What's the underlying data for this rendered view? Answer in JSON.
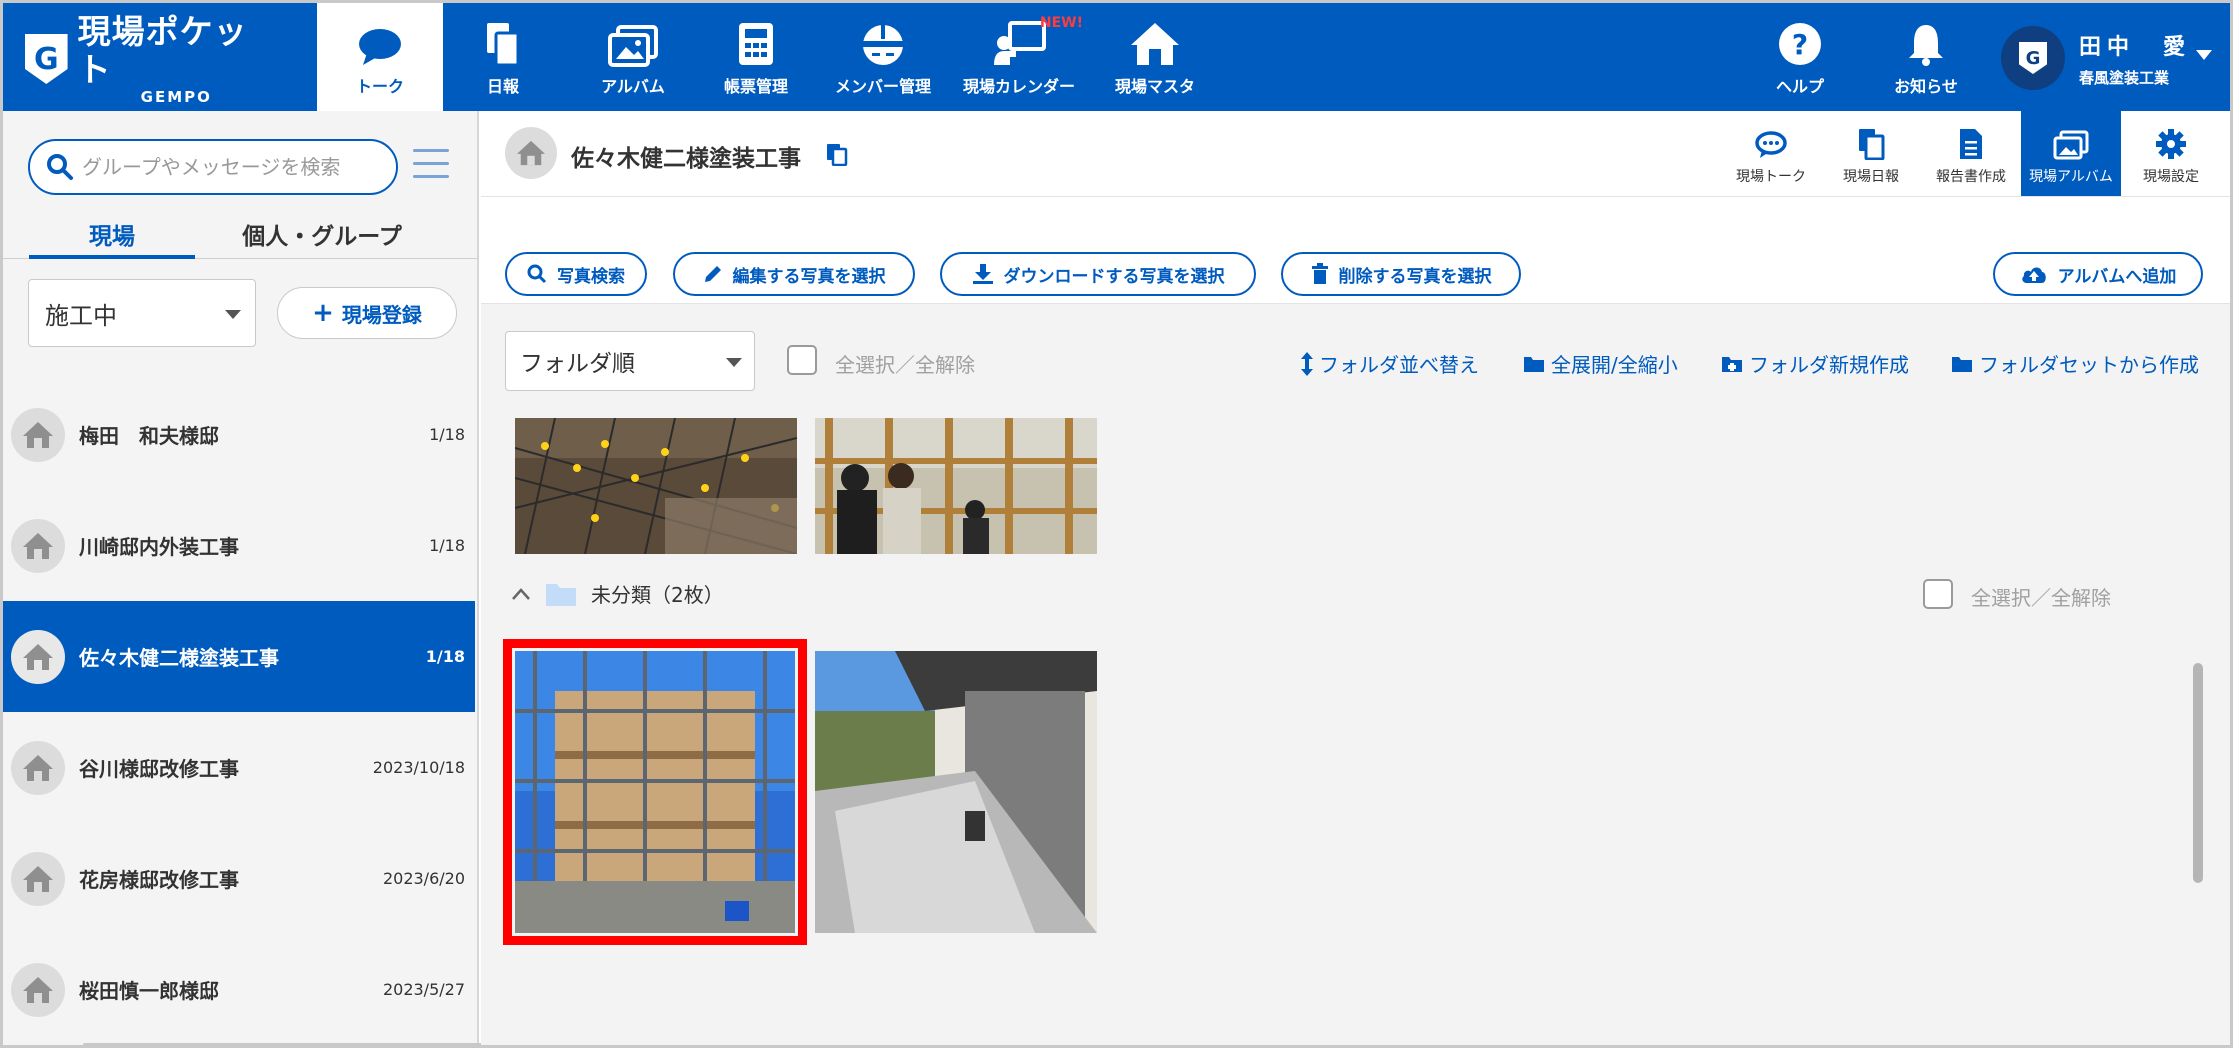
{
  "app": {
    "logo_title": "現場ポケット",
    "logo_sub": "GEMPO",
    "brand_color": "#005bbf"
  },
  "nav": [
    {
      "label": "トーク",
      "icon": "chat-bubble-icon",
      "active": true
    },
    {
      "label": "日報",
      "icon": "daily-report-icon"
    },
    {
      "label": "アルバム",
      "icon": "album-icon"
    },
    {
      "label": "帳票管理",
      "icon": "calculator-icon"
    },
    {
      "label": "メンバー管理",
      "icon": "helmet-icon"
    },
    {
      "label": "現場カレンダー",
      "icon": "presenter-icon",
      "badge": "NEW!"
    },
    {
      "label": "現場マスタ",
      "icon": "house-icon"
    }
  ],
  "header_right": {
    "help": "ヘルプ",
    "notice": "お知らせ",
    "user_name": "田中　愛",
    "user_company": "春風塗装工業"
  },
  "sidebar": {
    "search_placeholder": "グループやメッセージを検索",
    "tabs": [
      "現場",
      "個人・グループ"
    ],
    "status_value": "施工中",
    "add_site_label": "現場登録",
    "sites": [
      {
        "name": "梅田　和夫様邸",
        "date": "1/18"
      },
      {
        "name": "川崎邸内外装工事",
        "date": "1/18"
      },
      {
        "name": "佐々木健二様塗装工事",
        "date": "1/18",
        "active": true
      },
      {
        "name": "谷川様邸改修工事",
        "date": "2023/10/18"
      },
      {
        "name": "花房様邸改修工事",
        "date": "2023/6/20"
      },
      {
        "name": "桜田慎一郎様邸",
        "date": "2023/5/27"
      }
    ]
  },
  "project": {
    "title": "佐々木健二様塗装工事",
    "tabs": [
      {
        "label": "現場トーク",
        "icon": "chat-icon"
      },
      {
        "label": "現場日報",
        "icon": "daily-report-icon"
      },
      {
        "label": "報告書作成",
        "icon": "document-icon"
      },
      {
        "label": "現場アルバム",
        "icon": "album-icon",
        "active": true
      },
      {
        "label": "現場設定",
        "icon": "gear-icon"
      }
    ]
  },
  "actions": {
    "search_photos": "写真検索",
    "edit_select": "編集する写真を選択",
    "download_select": "ダウンロードする写真を選択",
    "delete_select": "削除する写真を選択",
    "add_album": "アルバムへ追加"
  },
  "album": {
    "sort_value": "フォルダ順",
    "select_all": "全選択／全解除",
    "folder_sort": "フォルダ並べ替え",
    "expand_collapse": "全展開/全縮小",
    "new_folder": "フォルダ新規作成",
    "from_folder_set": "フォルダセットから作成",
    "folder_name": "未分類（2枚）",
    "folder_select_all": "全選択／全解除"
  }
}
